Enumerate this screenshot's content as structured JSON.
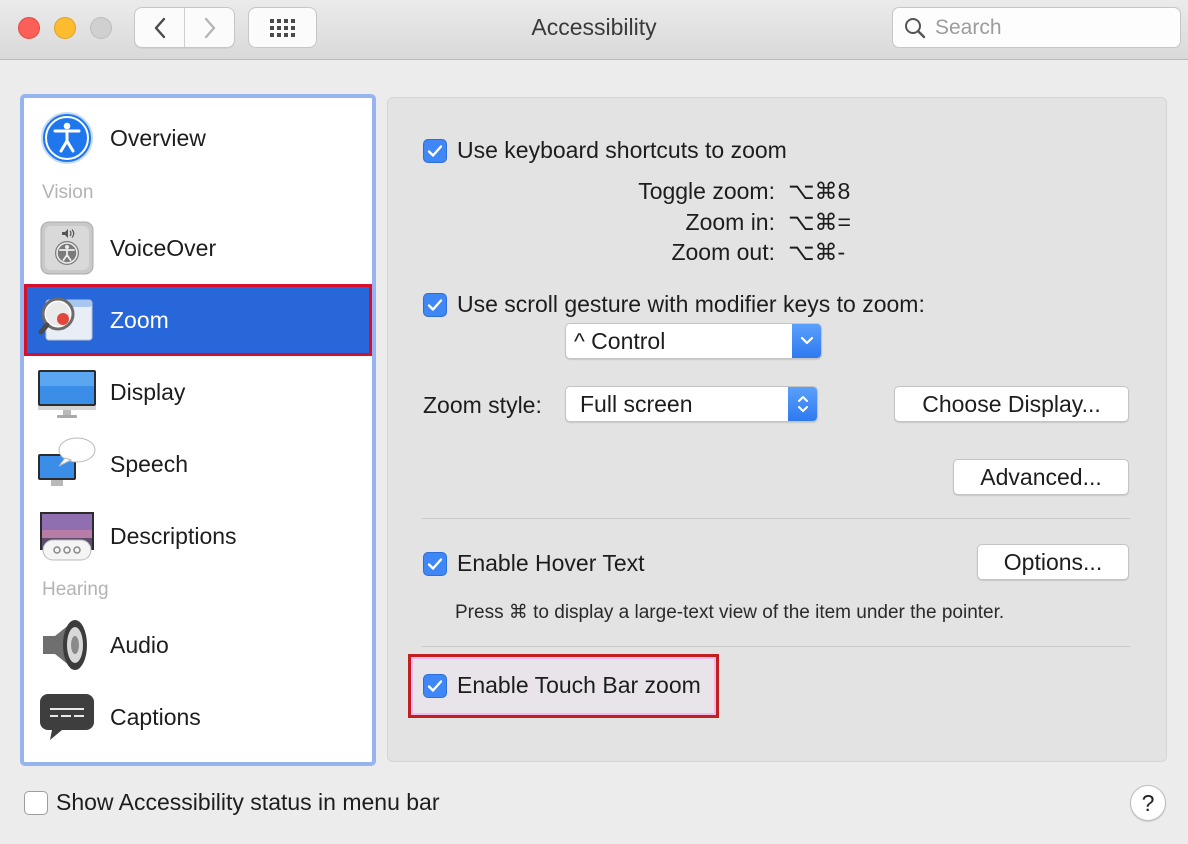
{
  "window": {
    "title": "Accessibility",
    "search_placeholder": "Search"
  },
  "sidebar": {
    "items": [
      {
        "label": "Overview",
        "icon": "accessibility-person-icon"
      },
      {
        "label": "VoiceOver",
        "icon": "voiceover-icon"
      },
      {
        "label": "Zoom",
        "icon": "zoom-magnifier-icon",
        "selected": true
      },
      {
        "label": "Display",
        "icon": "display-monitor-icon"
      },
      {
        "label": "Speech",
        "icon": "speech-bubble-icon"
      },
      {
        "label": "Descriptions",
        "icon": "descriptions-icon"
      },
      {
        "label": "Audio",
        "icon": "speaker-icon"
      },
      {
        "label": "Captions",
        "icon": "captions-icon"
      }
    ],
    "sections": {
      "vision": "Vision",
      "hearing": "Hearing"
    }
  },
  "zoom": {
    "keyboard_shortcuts": {
      "label": "Use keyboard shortcuts to zoom",
      "checked": true,
      "toggle_label": "Toggle zoom:",
      "toggle_key": "⌥⌘8",
      "in_label": "Zoom in:",
      "in_key": "⌥⌘=",
      "out_label": "Zoom out:",
      "out_key": "⌥⌘-"
    },
    "scroll_gesture": {
      "label": "Use scroll gesture with modifier keys to zoom:",
      "checked": true,
      "modifier_value": "^ Control"
    },
    "zoom_style": {
      "label": "Zoom style:",
      "value": "Full screen"
    },
    "choose_display_label": "Choose Display...",
    "advanced_label": "Advanced...",
    "hover_text": {
      "label": "Enable Hover Text",
      "checked": true,
      "options_label": "Options...",
      "hint": "Press ⌘ to display a large-text view of the item under the pointer."
    },
    "touch_bar": {
      "label": "Enable Touch Bar zoom",
      "checked": true
    }
  },
  "bottom": {
    "status_label": "Show Accessibility status in menu bar",
    "status_checked": false,
    "help_label": "?"
  },
  "colors": {
    "accent": "#3f86f6",
    "selection": "#2767d9",
    "highlight_red": "#d6102a"
  }
}
